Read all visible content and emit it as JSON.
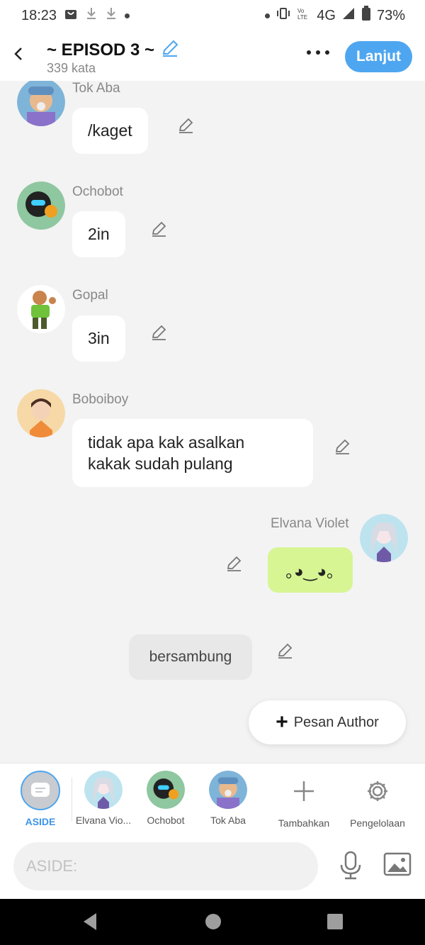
{
  "status_bar": {
    "time": "18:23",
    "network": "4G",
    "battery": "73%"
  },
  "header": {
    "title": "~ EPISOD 3 ~",
    "word_count": "339 kata",
    "next_label": "Lanjut"
  },
  "messages": [
    {
      "sender": "Tok Aba",
      "text": "/kaget"
    },
    {
      "sender": "Ochobot",
      "text": "2in"
    },
    {
      "sender": "Gopal",
      "text": "3in"
    },
    {
      "sender": "Boboiboy",
      "text_line1": "tidak apa kak asalkan",
      "text_line2": "kakak sudah pulang"
    },
    {
      "sender": "Elvana Violet",
      "text": "｡◕‿◕｡"
    },
    {
      "sender": "",
      "text": "bersambung"
    }
  ],
  "author_message_button": "Pesan Author",
  "character_bar": {
    "items": [
      {
        "label": "ASIDE"
      },
      {
        "label": "Elvana Vio..."
      },
      {
        "label": "Ochobot"
      },
      {
        "label": "Tok Aba"
      },
      {
        "label": "Tambahkan"
      },
      {
        "label": "Pengelolaan"
      }
    ]
  },
  "input": {
    "placeholder": "ASIDE:"
  },
  "colors": {
    "accent": "#4ea6f0",
    "own_bubble": "#d7f593",
    "aside_bubble": "#e8e8e8"
  }
}
